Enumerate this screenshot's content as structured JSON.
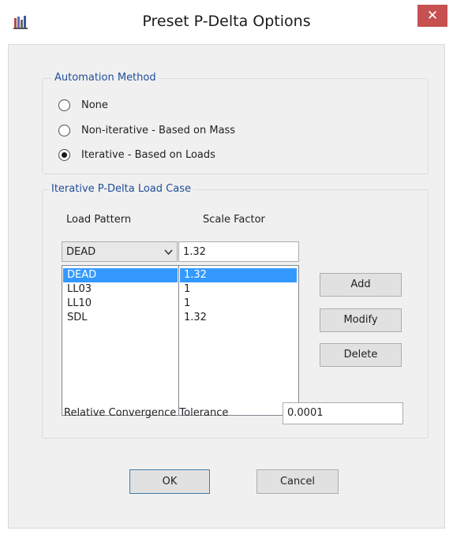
{
  "window": {
    "title": "Preset P-Delta Options",
    "close_label": "✕"
  },
  "automation": {
    "legend": "Automation Method",
    "options": [
      {
        "label": "None",
        "checked": false
      },
      {
        "label": "Non-iterative - Based on Mass",
        "checked": false
      },
      {
        "label": "Iterative - Based on Loads",
        "checked": true
      }
    ]
  },
  "load_case": {
    "legend": "Iterative P-Delta Load Case",
    "col_load_pattern": "Load Pattern",
    "col_scale_factor": "Scale Factor",
    "combo_value": "DEAD",
    "scale_value": "1.32",
    "rows": [
      {
        "pattern": "DEAD",
        "scale": "1.32",
        "selected": true
      },
      {
        "pattern": "LL03",
        "scale": "1",
        "selected": false
      },
      {
        "pattern": "LL10",
        "scale": "1",
        "selected": false
      },
      {
        "pattern": "SDL",
        "scale": "1.32",
        "selected": false
      }
    ],
    "add_label": "Add",
    "modify_label": "Modify",
    "delete_label": "Delete",
    "tolerance_label": "Relative Convergence Tolerance",
    "tolerance_value": "0.0001"
  },
  "footer": {
    "ok_label": "OK",
    "cancel_label": "Cancel"
  }
}
